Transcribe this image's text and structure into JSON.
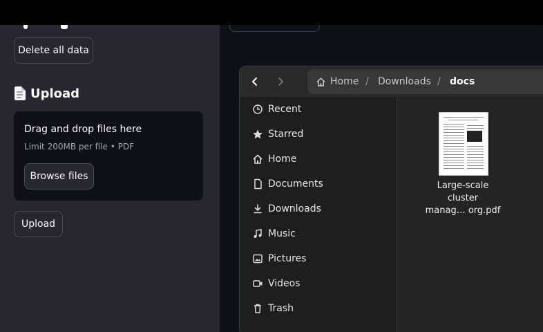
{
  "sidebar": {
    "delete_button": "Delete all data",
    "upload_heading": "Upload",
    "upload_icon": "page-facing-up-icon",
    "dropzone": {
      "title": "Drag and drop files here",
      "subtitle": "Limit 200MB per file • PDF",
      "browse_button": "Browse files"
    },
    "upload_button": "Upload"
  },
  "file_chooser": {
    "back_icon": "chevron-left-icon",
    "forward_icon": "chevron-right-icon",
    "breadcrumbs": [
      "Home",
      "/",
      "Downloads",
      "/",
      "docs"
    ],
    "places": [
      {
        "label": "Recent",
        "icon": "clock-icon"
      },
      {
        "label": "Starred",
        "icon": "star-icon"
      },
      {
        "label": "Home",
        "icon": "home-icon"
      },
      {
        "label": "Documents",
        "icon": "document-icon"
      },
      {
        "label": "Downloads",
        "icon": "download-icon"
      },
      {
        "label": "Music",
        "icon": "music-icon"
      },
      {
        "label": "Pictures",
        "icon": "picture-icon"
      },
      {
        "label": "Videos",
        "icon": "video-icon"
      },
      {
        "label": "Trash",
        "icon": "trash-icon"
      }
    ],
    "files": [
      {
        "name_lines": [
          "Large-scale",
          "cluster",
          "manag…  org.pdf"
        ]
      }
    ]
  },
  "colors": {
    "sidebar_bg": "#262730",
    "main_bg": "#0e1117",
    "dialog_bg": "#1e1e1e",
    "header_bg": "#2a2a2a"
  }
}
